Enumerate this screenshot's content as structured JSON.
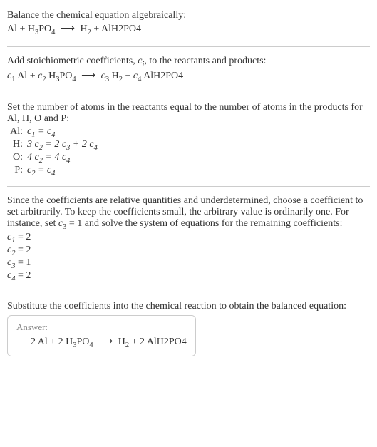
{
  "intro": {
    "line1": "Balance the chemical equation algebraically:",
    "eq_lhs1": "Al + H",
    "eq_lhs2": "PO",
    "eq_rhs1": "H",
    "eq_rhs2": " + AlH2PO4",
    "sub3": "3",
    "sub4": "4",
    "sub2": "2",
    "arrow": "⟶"
  },
  "stoich": {
    "text1": "Add stoichiometric coefficients, ",
    "ci": "c",
    "ci_sub": "i",
    "text2": ", to the reactants and products:",
    "c1": "c",
    "c1s": "1",
    "al": " Al + ",
    "c2": "c",
    "c2s": "2",
    "h3po4_a": " H",
    "h3po4_b": "PO",
    "arrow": "⟶",
    "c3": "c",
    "c3s": "3",
    "h2": " H",
    "plus": " + ",
    "c4": "c",
    "c4s": "4",
    "alh2po4": " AlH2PO4"
  },
  "atoms": {
    "intro": "Set the number of atoms in the reactants equal to the number of atoms in the products for Al, H, O and P:",
    "rows": [
      {
        "label": "Al:",
        "lhs": "c",
        "lhs_s": "1",
        "eq": " = ",
        "rhs": "c",
        "rhs_s": "4",
        "extra": ""
      },
      {
        "label": "H:",
        "lhs": "3 c",
        "lhs_s": "2",
        "eq": " = 2 ",
        "rhs": "c",
        "rhs_s": "3",
        "extra_pre": " + 2 ",
        "extra": "c",
        "extra_s": "4"
      },
      {
        "label": "O:",
        "lhs": "4 c",
        "lhs_s": "2",
        "eq": " = 4 ",
        "rhs": "c",
        "rhs_s": "4",
        "extra": ""
      },
      {
        "label": "P:",
        "lhs": "c",
        "lhs_s": "2",
        "eq": " = ",
        "rhs": "c",
        "rhs_s": "4",
        "extra": ""
      }
    ]
  },
  "solve": {
    "text_a": "Since the coefficients are relative quantities and underdetermined, choose a coefficient to set arbitrarily. To keep the coefficients small, the arbitrary value is ordinarily one. For instance, set ",
    "c3": "c",
    "c3s": "3",
    "text_b": " = 1 and solve the system of equations for the remaining coefficients:",
    "coeffs": [
      {
        "c": "c",
        "s": "1",
        "v": " = 2"
      },
      {
        "c": "c",
        "s": "2",
        "v": " = 2"
      },
      {
        "c": "c",
        "s": "3",
        "v": " = 1"
      },
      {
        "c": "c",
        "s": "4",
        "v": " = 2"
      }
    ]
  },
  "final": {
    "text": "Substitute the coefficients into the chemical reaction to obtain the balanced equation:",
    "answer_label": "Answer:",
    "eq_a": "2 Al + 2 H",
    "eq_b": "PO",
    "arrow": "⟶",
    "eq_c": "H",
    "eq_d": " + 2 AlH2PO4"
  }
}
